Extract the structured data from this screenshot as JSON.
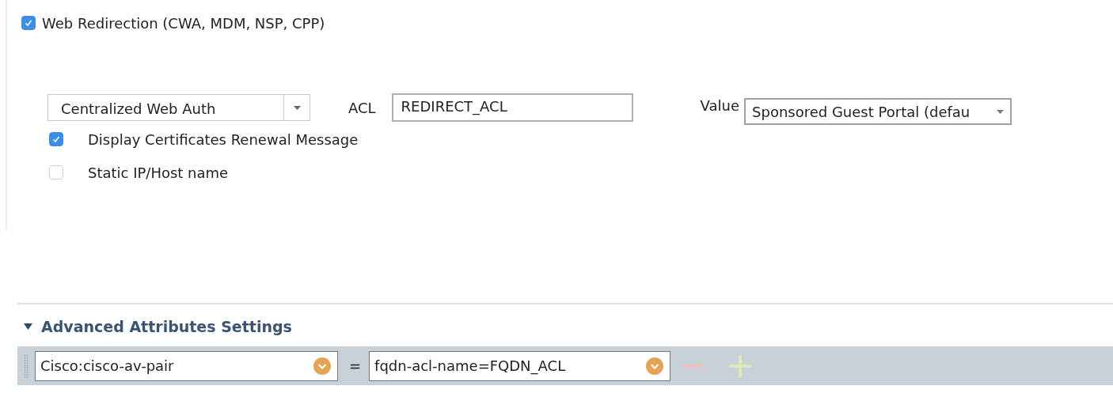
{
  "redirection": {
    "label": "Web Redirection (CWA, MDM, NSP, CPP)",
    "checked": true,
    "type": {
      "value": "Centralized Web Auth"
    },
    "acl": {
      "label": "ACL",
      "value": "REDIRECT_ACL"
    },
    "portal": {
      "label": "Value",
      "value": "Sponsored Guest Portal (defau"
    },
    "options": [
      {
        "label": "Display Certificates Renewal Message",
        "checked": true
      },
      {
        "label": "Static IP/Host name",
        "checked": false
      }
    ]
  },
  "advanced": {
    "title": "Advanced Attributes Settings",
    "expanded": true,
    "rows": [
      {
        "attribute": "Cisco:cisco-av-pair",
        "operator": "=",
        "value": "fqdn-acl-name=FQDN_ACL"
      }
    ]
  }
}
